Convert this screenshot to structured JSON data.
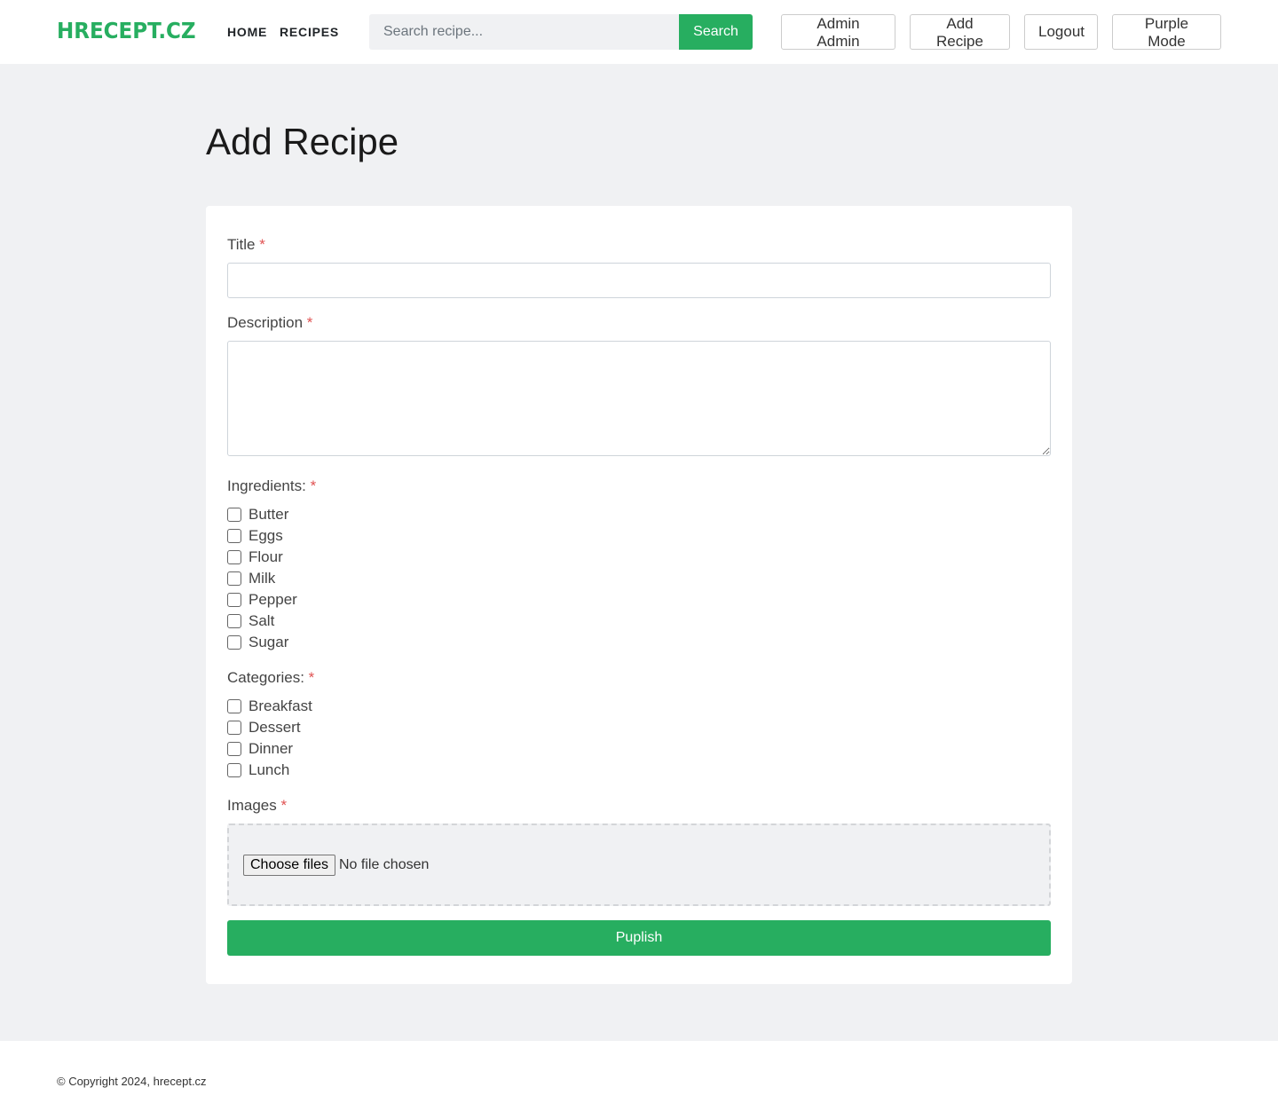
{
  "header": {
    "logo": "HRECEPT.CZ",
    "nav": {
      "home": "HOME",
      "recipes": "RECIPES"
    },
    "search": {
      "placeholder": "Search recipe...",
      "button": "Search"
    },
    "buttons": {
      "admin": "Admin Admin",
      "add_recipe": "Add Recipe",
      "logout": "Logout",
      "purple_mode": "Purple Mode"
    }
  },
  "page": {
    "title": "Add Recipe"
  },
  "form": {
    "required_marker": "*",
    "title_label": "Title",
    "description_label": "Description",
    "ingredients_label": "Ingredients:",
    "ingredients": [
      "Butter",
      "Eggs",
      "Flour",
      "Milk",
      "Pepper",
      "Salt",
      "Sugar"
    ],
    "categories_label": "Categories:",
    "categories": [
      "Breakfast",
      "Dessert",
      "Dinner",
      "Lunch"
    ],
    "images_label": "Images",
    "file_button": "Choose files",
    "file_status": "No file chosen",
    "submit": "Puplish"
  },
  "footer": {
    "copyright": "© Copyright 2024, hrecept.cz"
  },
  "colors": {
    "accent": "#27ae60",
    "required": "#e05252",
    "background": "#f0f1f3"
  }
}
